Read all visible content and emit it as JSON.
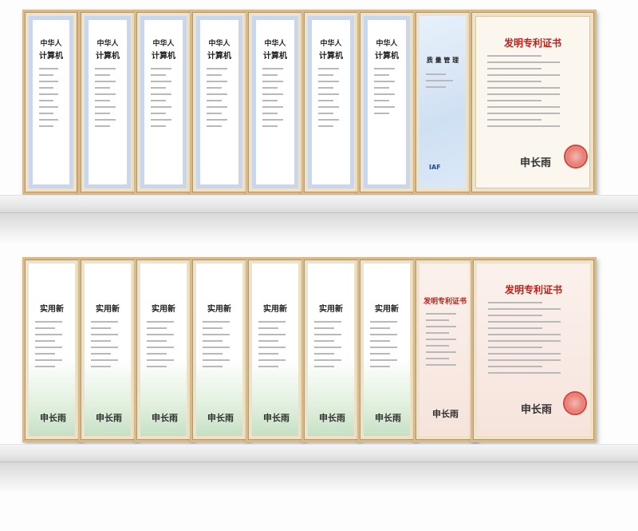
{
  "row1": {
    "software_title_line1": "中华人",
    "software_title_line2": "计算机",
    "quality_title": "质 量 管 理",
    "quality_badge": "IAF",
    "patent_title": "发明专利证书",
    "patent_signature": "申长雨"
  },
  "row2": {
    "utility_title": "实用新",
    "patent_title": "发明专利证书",
    "patent_signature": "申长雨",
    "utility_signature": "申长雨"
  },
  "colors": {
    "frame": "#d7b98a",
    "patent_red": "#c0201b",
    "seal": "#d4473e"
  }
}
